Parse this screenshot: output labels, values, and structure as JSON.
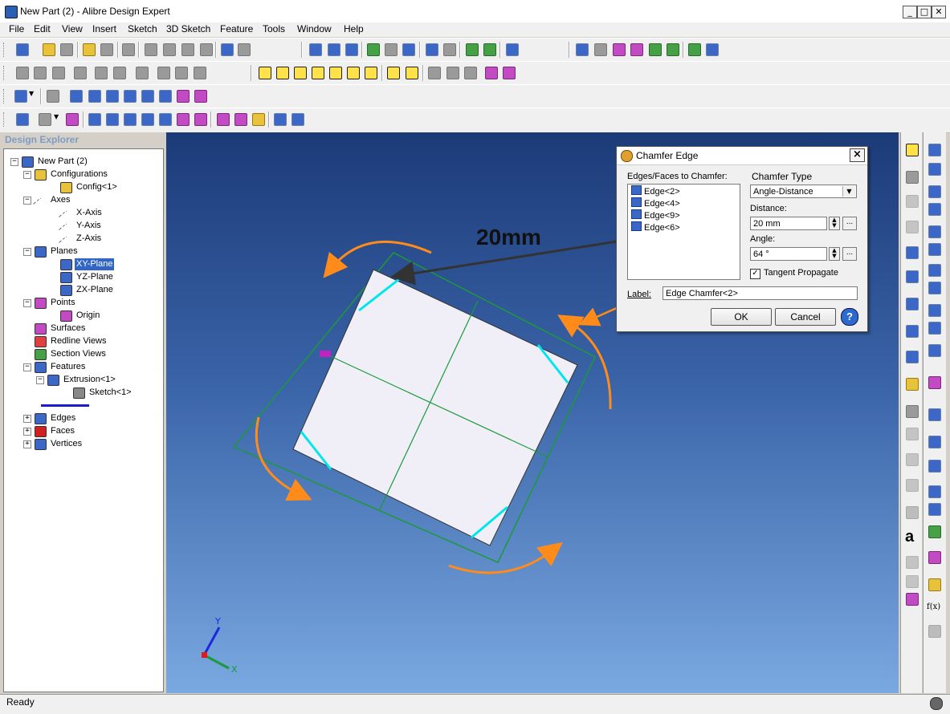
{
  "window": {
    "title": "New Part (2) - Alibre Design Expert",
    "min_label": "_",
    "max_label": "□",
    "close_label": "✕"
  },
  "menu": [
    "File",
    "Edit",
    "View",
    "Insert",
    "Sketch",
    "3D Sketch",
    "Feature",
    "Tools",
    "Window",
    "Help"
  ],
  "explorer": {
    "header": "Design Explorer",
    "tree": [
      {
        "label": "New Part (2)",
        "icon": "part-icon",
        "expander": "−",
        "selected": false
      },
      {
        "label": "Configurations",
        "icon": "configurations-icon",
        "expander": "−",
        "selected": false
      },
      {
        "label": "Config<1>",
        "icon": "config-icon",
        "expander": "",
        "selected": false
      },
      {
        "label": "Axes",
        "icon": "axes-icon",
        "expander": "−",
        "selected": false
      },
      {
        "label": "X-Axis",
        "icon": "axis-icon",
        "expander": "",
        "selected": false
      },
      {
        "label": "Y-Axis",
        "icon": "axis-icon",
        "expander": "",
        "selected": false
      },
      {
        "label": "Z-Axis",
        "icon": "axis-icon",
        "expander": "",
        "selected": false
      },
      {
        "label": "Planes",
        "icon": "planes-icon",
        "expander": "−",
        "selected": false
      },
      {
        "label": "XY-Plane",
        "icon": "plane-icon",
        "expander": "",
        "selected": true
      },
      {
        "label": "YZ-Plane",
        "icon": "plane-icon",
        "expander": "",
        "selected": false
      },
      {
        "label": "ZX-Plane",
        "icon": "plane-icon",
        "expander": "",
        "selected": false
      },
      {
        "label": "Points",
        "icon": "points-icon",
        "expander": "−",
        "selected": false
      },
      {
        "label": "Origin",
        "icon": "origin-icon",
        "expander": "",
        "selected": false
      },
      {
        "label": "Surfaces",
        "icon": "surfaces-icon",
        "expander": "",
        "selected": false
      },
      {
        "label": "Redline Views",
        "icon": "redline-icon",
        "expander": "",
        "selected": false
      },
      {
        "label": "Section Views",
        "icon": "section-icon",
        "expander": "",
        "selected": false
      },
      {
        "label": "Features",
        "icon": "features-icon",
        "expander": "−",
        "selected": false
      },
      {
        "label": "Extrusion<1>",
        "icon": "extrusion-icon",
        "expander": "−",
        "selected": false
      },
      {
        "label": "Sketch<1>",
        "icon": "sketch-icon",
        "expander": "",
        "selected": false
      },
      {
        "label": "",
        "icon": "rollback-bar-icon",
        "expander": "",
        "selected": false
      },
      {
        "label": "Edges",
        "icon": "edges-icon",
        "expander": "+",
        "selected": false
      },
      {
        "label": "Faces",
        "icon": "faces-icon",
        "expander": "+",
        "selected": false
      },
      {
        "label": "Vertices",
        "icon": "vertices-icon",
        "expander": "+",
        "selected": false
      }
    ]
  },
  "dialog": {
    "title": "Chamfer Edge",
    "edges_label": "Edges/Faces to Chamfer:",
    "edges": [
      "Edge<2>",
      "Edge<4>",
      "Edge<9>",
      "Edge<6>"
    ],
    "chamfer_type_label": "Chamfer Type",
    "chamfer_type_value": "Angle-Distance",
    "distance_label": "Distance:",
    "distance_value": "20 mm",
    "angle_label": "Angle:",
    "angle_value": "64 °",
    "tangent_label": "Tangent Propagate",
    "tangent_checked": "✓",
    "label_label": "Label:",
    "label_value": "Edge Chamfer<2>",
    "ok": "OK",
    "cancel": "Cancel",
    "help": "?",
    "spin_up": "▲",
    "spin_down": "▼",
    "dots": "...",
    "dropdown": "▼"
  },
  "annotation": {
    "text": "20mm",
    "colors": {
      "arrow": "#333333",
      "orange": "#ff8c1a",
      "chamfer": "#00e5ee",
      "outline": "#1a9a3a"
    }
  },
  "triad": {
    "y_label": "Y",
    "x_label": "X"
  },
  "status": {
    "text": "Ready"
  }
}
